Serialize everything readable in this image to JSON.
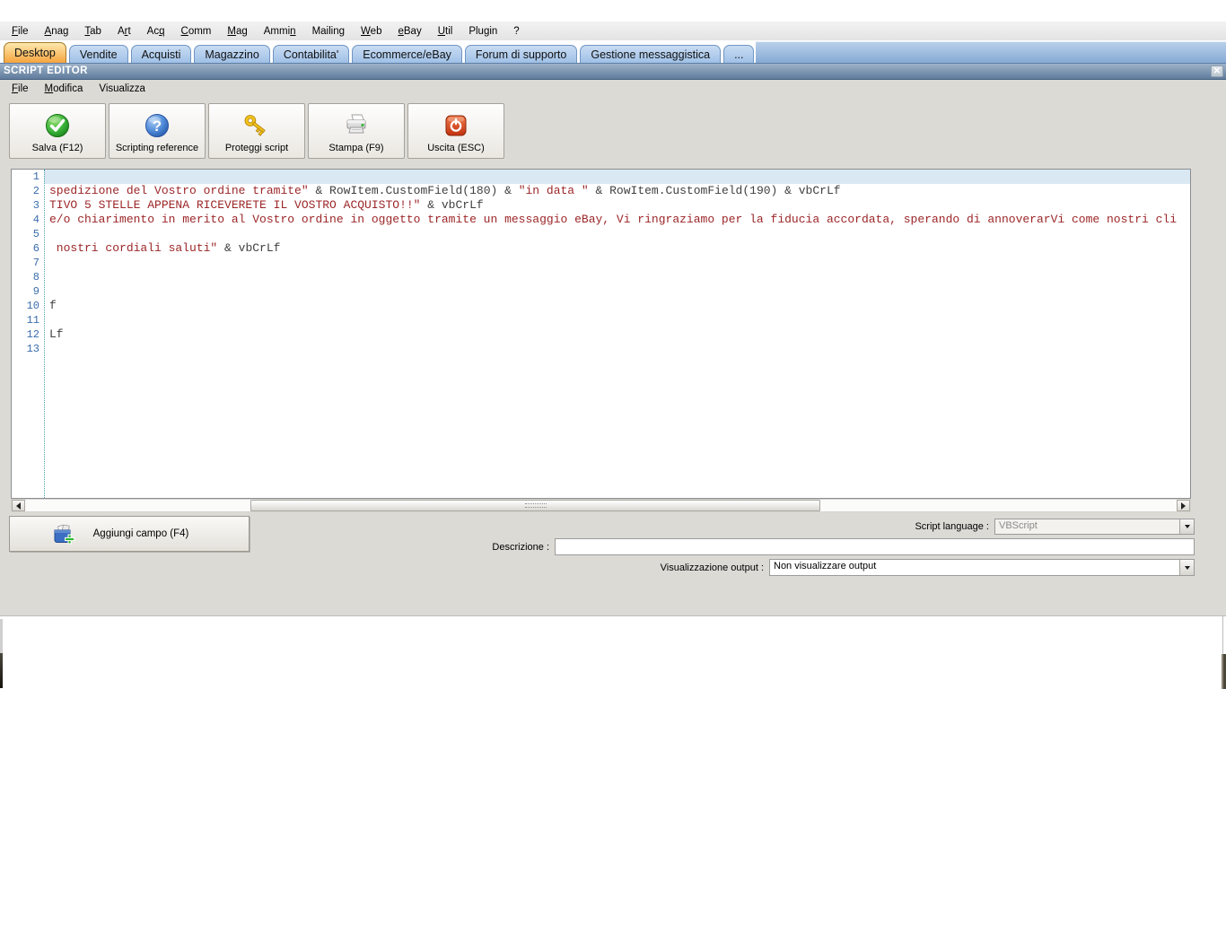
{
  "menu_bar": {
    "items": [
      {
        "label": "File",
        "u": 0
      },
      {
        "label": "Anag",
        "u": 0
      },
      {
        "label": "Tab",
        "u": 0
      },
      {
        "label": "Art",
        "u": 1
      },
      {
        "label": "Acq",
        "u": 2
      },
      {
        "label": "Comm",
        "u": 0
      },
      {
        "label": "Mag",
        "u": 0
      },
      {
        "label": "Ammin",
        "u": 4
      },
      {
        "label": "Mailing",
        "u": 6
      },
      {
        "label": "Web",
        "u": 0
      },
      {
        "label": "eBay",
        "u": 0
      },
      {
        "label": "Util",
        "u": 0
      },
      {
        "label": "Plugin",
        "u": -1
      },
      {
        "label": "?",
        "u": -1
      }
    ]
  },
  "tab_bar": {
    "tabs": [
      {
        "label": "Desktop",
        "active": true
      },
      {
        "label": "Vendite",
        "active": false
      },
      {
        "label": "Acquisti",
        "active": false
      },
      {
        "label": "Magazzino",
        "active": false
      },
      {
        "label": "Contabilita'",
        "active": false
      },
      {
        "label": "Ecommerce/eBay",
        "active": false
      },
      {
        "label": "Forum di supporto",
        "active": false
      },
      {
        "label": "Gestione messaggistica",
        "active": false
      },
      {
        "label": "...",
        "active": false
      }
    ]
  },
  "window": {
    "title": "SCRIPT EDITOR",
    "close_icon": "✕"
  },
  "editor_menu": {
    "items": [
      {
        "label": "File",
        "u": 0
      },
      {
        "label": "Modifica",
        "u": 0
      },
      {
        "label": "Visualizza",
        "u": -1
      }
    ]
  },
  "toolbar": {
    "buttons": [
      {
        "label": "Salva (F12)",
        "icon": "save-check-icon"
      },
      {
        "label": "Scripting reference",
        "icon": "help-question-icon"
      },
      {
        "label": "Proteggi script",
        "icon": "key-icon"
      },
      {
        "label": "Stampa (F9)",
        "icon": "printer-icon"
      },
      {
        "label": "Uscita (ESC)",
        "icon": "exit-power-icon"
      }
    ]
  },
  "editor": {
    "current_line": 1,
    "lines": [
      [],
      [
        {
          "k": "str",
          "t": "spedizione del Vostro ordine tramite\""
        },
        {
          "k": "code",
          "t": " & RowItem.CustomField(180) & "
        },
        {
          "k": "str",
          "t": "\"in data \""
        },
        {
          "k": "code",
          "t": " & RowItem.CustomField(190) & vbCrLf"
        }
      ],
      [
        {
          "k": "str",
          "t": "TIVO 5 STELLE APPENA RICEVERETE IL VOSTRO ACQUISTO!!\""
        },
        {
          "k": "code",
          "t": " & vbCrLf"
        }
      ],
      [
        {
          "k": "str",
          "t": "e/o chiarimento in merito al Vostro ordine in oggetto tramite un messaggio eBay, Vi ringraziamo per la fiducia accordata, sperando di annoverarVi come nostri cli"
        }
      ],
      [],
      [
        {
          "k": "str",
          "t": " nostri cordiali saluti\""
        },
        {
          "k": "code",
          "t": " & vbCrLf"
        }
      ],
      [],
      [],
      [],
      [
        {
          "k": "code",
          "t": "f"
        }
      ],
      [],
      [
        {
          "k": "code",
          "t": "Lf"
        }
      ],
      []
    ]
  },
  "bottom_panel": {
    "add_field_label": "Aggiungi campo (F4)",
    "script_language_label": "Script language :",
    "script_language_value": "VBScript",
    "description_label": "Descrizione :",
    "description_value": "",
    "output_label": "Visualizzazione output :",
    "output_value": "Non visualizzare output"
  },
  "colors": {
    "active_tab_orange": "#f6a13a",
    "inactive_tab_blue": "#9dbfe6",
    "titlebar_blue": "#6d89a8",
    "string_text_red": "#9c2628",
    "code_text": "#3f3f3f",
    "line_number_blue": "#3a6cab",
    "current_line_highlight": "#d9e8f3"
  }
}
